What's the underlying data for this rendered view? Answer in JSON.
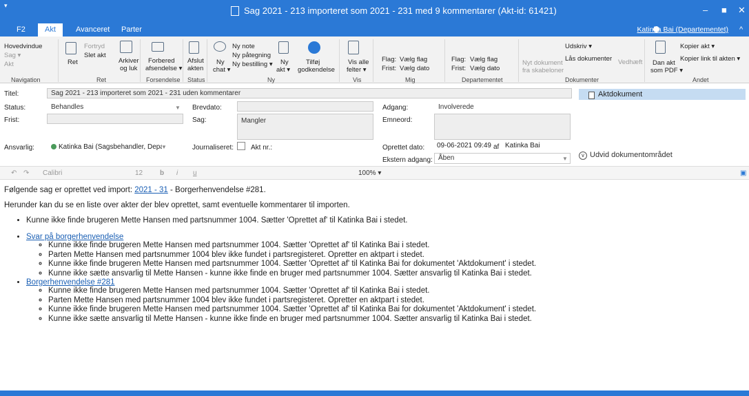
{
  "window": {
    "title": "Sag 2021 - 213 importeret som 2021 - 231 med 9 kommentarer (Akt-id: 61421)",
    "quick_access": "▾",
    "minimize": "–",
    "maximize": "■",
    "close": "✕"
  },
  "tabs": {
    "f2": "F2",
    "akt": "Akt",
    "avanceret": "Avanceret",
    "parter": "Parter"
  },
  "user": {
    "name": "Katinka Bai (Departementet)",
    "collapse": "^"
  },
  "ribbon": {
    "hovedvindue": "Hovedvindue",
    "sag": "Sag ▾",
    "akt": "Akt",
    "navigation": "Navigation",
    "ret": "Ret",
    "fortryd": "Fortryd",
    "slet_akt": "Slet akt",
    "arkiver": "Arkiver",
    "og_luk": "og luk",
    "ret_group": "Ret",
    "forbered": "Forbered",
    "afsendelse": "afsendelse ▾",
    "forsendelse": "Forsendelse",
    "afslut": "Afslut",
    "akten": "akten",
    "status": "Status",
    "ny_chat1": "Ny",
    "ny_chat2": "chat ▾",
    "ny_note": "Ny note",
    "ny_paategning": "Ny påtegning",
    "ny_bestilling": "Ny bestilling ▾",
    "ny_akt1": "Ny",
    "ny_akt2": "akt ▾",
    "tilfoej1": "Tilføj",
    "tilfoej2": "godkendelse",
    "ny_group": "Ny",
    "vis_alle1": "Vis alle",
    "vis_alle2": "felter ▾",
    "vis": "Vis",
    "flag": "Flag:",
    "vaelg_flag": "Vælg flag",
    "frist": "Frist:",
    "vaelg_dato": "Vælg dato",
    "mig": "Mig",
    "dep_flag": "Flag:",
    "dep_vaelg_flag": "Vælg flag",
    "dep_frist": "Frist:",
    "dep_vaelg_dato": "Vælg dato",
    "departementet": "Departementet",
    "nyt_dok1": "Nyt dokument",
    "nyt_dok2": "fra skabeloner",
    "udskriv": "Udskriv ▾",
    "laas": "Lås dokumenter",
    "vedhaeft": "Vedhæft",
    "dokumenter": "Dokumenter",
    "dan_akt1": "Dan akt",
    "dan_akt2": "som PDF ▾",
    "kopier_akt": "Kopier akt ▾",
    "kopier_link": "Kopier link til akten ▾",
    "andet": "Andet"
  },
  "fields": {
    "titel_label": "Titel:",
    "titel_value": "Sag 2021 - 213 importeret som 2021 - 231 uden kommentarer",
    "status_label": "Status:",
    "status_value": "Behandles",
    "frist_label": "Frist:",
    "brevdato_label": "Brevdato:",
    "sag_label": "Sag:",
    "sag_value": "Mangler",
    "adgang_label": "Adgang:",
    "adgang_value": "Involverede",
    "emneord_label": "Emneord:",
    "ansvarlig_label": "Ansvarlig:",
    "ansvarlig_value": "Katinka Bai (Sagsbehandler, Departem",
    "journaliseret_label": "Journaliseret:",
    "akt_nr_label": "Akt nr.:",
    "oprettet_label": "Oprettet dato:",
    "oprettet_value": "09-06-2021 09:49",
    "af": "af",
    "oprettet_af": "Katinka Bai",
    "ekstern_label": "Ekstern adgang:",
    "ekstern_value": "Åben"
  },
  "docs": {
    "aktdokument": "Aktdokument",
    "udvid": "Udvid dokumentområdet"
  },
  "editor": {
    "font": "Calibri",
    "size": "12",
    "zoom": "100% ▾"
  },
  "content": {
    "intro_pre": "Følgende sag er oprettet ved import: ",
    "intro_link": "2021 - 31",
    "intro_post": " - Borgerhenvendelse #281.",
    "para2": "Herunder kan du se en liste over akter der blev oprettet, samt eventuelle kommentarer til importen.",
    "top_item": "Kunne ikke finde brugeren Mette Hansen med partsnummer 1004. Sætter 'Oprettet af' til Katinka Bai i stedet.",
    "groups": [
      {
        "link": "Svar på borgerhenvendelse",
        "items": [
          "Kunne ikke finde brugeren Mette Hansen med partsnummer 1004. Sætter 'Oprettet af' til Katinka Bai i stedet.",
          "Parten Mette Hansen med partsnummer 1004 blev ikke fundet i partsregisteret. Opretter en aktpart i stedet.",
          "Kunne ikke finde brugeren Mette Hansen med partsnummer 1004. Sætter 'Oprettet af' til Katinka Bai for dokumentet 'Aktdokument' i stedet.",
          "Kunne ikke sætte ansvarlig til Mette Hansen - kunne ikke finde en bruger med partsnummer 1004. Sætter ansvarlig til Katinka Bai i stedet."
        ]
      },
      {
        "link": "Borgerhenvendelse #281",
        "items": [
          "Kunne ikke finde brugeren Mette Hansen med partsnummer 1004. Sætter 'Oprettet af' til Katinka Bai i stedet.",
          "Parten Mette Hansen med partsnummer 1004 blev ikke fundet i partsregisteret. Opretter en aktpart i stedet.",
          "Kunne ikke finde brugeren Mette Hansen med partsnummer 1004. Sætter 'Oprettet af' til Katinka Bai for dokumentet 'Aktdokument' i stedet.",
          "Kunne ikke sætte ansvarlig til Mette Hansen - kunne ikke finde en bruger med partsnummer 1004. Sætter ansvarlig til Katinka Bai i stedet."
        ]
      }
    ]
  }
}
